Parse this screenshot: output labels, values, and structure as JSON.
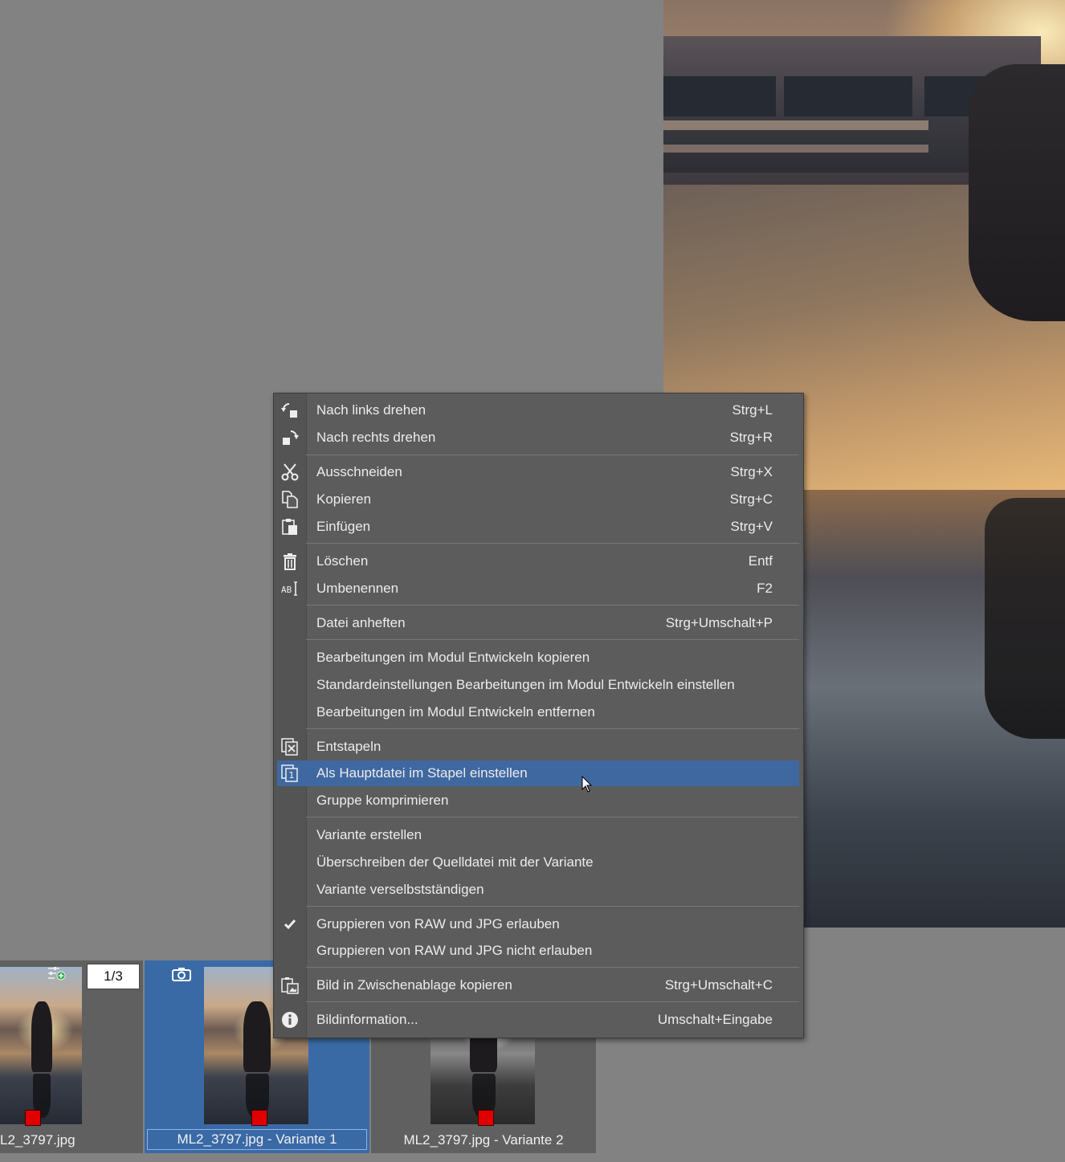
{
  "menu": {
    "items": [
      {
        "label": "Nach links drehen",
        "shortcut": "Strg+L",
        "icon": "rotate-left-icon"
      },
      {
        "label": "Nach rechts drehen",
        "shortcut": "Strg+R",
        "icon": "rotate-right-icon"
      },
      {
        "label": "Ausschneiden",
        "shortcut": "Strg+X",
        "icon": "scissors-icon"
      },
      {
        "label": "Kopieren",
        "shortcut": "Strg+C",
        "icon": "copy-icon"
      },
      {
        "label": "Einfügen",
        "shortcut": "Strg+V",
        "icon": "paste-icon"
      },
      {
        "label": "Löschen",
        "shortcut": "Entf",
        "icon": "trash-icon"
      },
      {
        "label": "Umbenennen",
        "shortcut": "F2",
        "icon": "rename-icon"
      },
      {
        "label": "Datei anheften",
        "shortcut": "Strg+Umschalt+P"
      },
      {
        "label": "Bearbeitungen im Modul Entwickeln kopieren",
        "shortcut": ""
      },
      {
        "label": "Standardeinstellungen Bearbeitungen im Modul Entwickeln einstellen",
        "shortcut": ""
      },
      {
        "label": "Bearbeitungen im Modul Entwickeln entfernen",
        "shortcut": ""
      },
      {
        "label": "Entstapeln",
        "shortcut": "",
        "icon": "unstack-icon"
      },
      {
        "label": "Als Hauptdatei im Stapel einstellen",
        "shortcut": "",
        "icon": "stack-main-icon",
        "highlighted": true
      },
      {
        "label": "Gruppe komprimieren",
        "shortcut": ""
      },
      {
        "label": "Variante erstellen",
        "shortcut": ""
      },
      {
        "label": "Überschreiben der Quelldatei mit der Variante",
        "shortcut": ""
      },
      {
        "label": "Variante verselbstständigen",
        "shortcut": ""
      },
      {
        "label": "Gruppieren von RAW und JPG erlauben",
        "shortcut": "",
        "icon": "checkmark-icon",
        "checked": true
      },
      {
        "label": "Gruppieren von RAW und JPG nicht erlauben",
        "shortcut": ""
      },
      {
        "label": "Bild in Zwischenablage kopieren",
        "shortcut": "Strg+Umschalt+C",
        "icon": "clipboard-image-icon"
      },
      {
        "label": "Bildinformation...",
        "shortcut": "Umschalt+Eingabe",
        "icon": "info-icon"
      }
    ]
  },
  "filmstrip": {
    "counter": "1/3",
    "thumbs": [
      {
        "name": "L2_3797.jpg",
        "style": "color",
        "color_label": "#e00000"
      },
      {
        "name": "ML2_3797.jpg - Variante 1",
        "style": "color",
        "selected": true,
        "color_label": "#e00000"
      },
      {
        "name": "ML2_3797.jpg - Variante 2",
        "style": "gray",
        "color_label": "#e00000"
      }
    ]
  },
  "colors": {
    "background": "#828282",
    "menu_bg": "#5c5c5c",
    "highlight": "#3f68a1",
    "selected_thumb": "#3a6aa6"
  }
}
